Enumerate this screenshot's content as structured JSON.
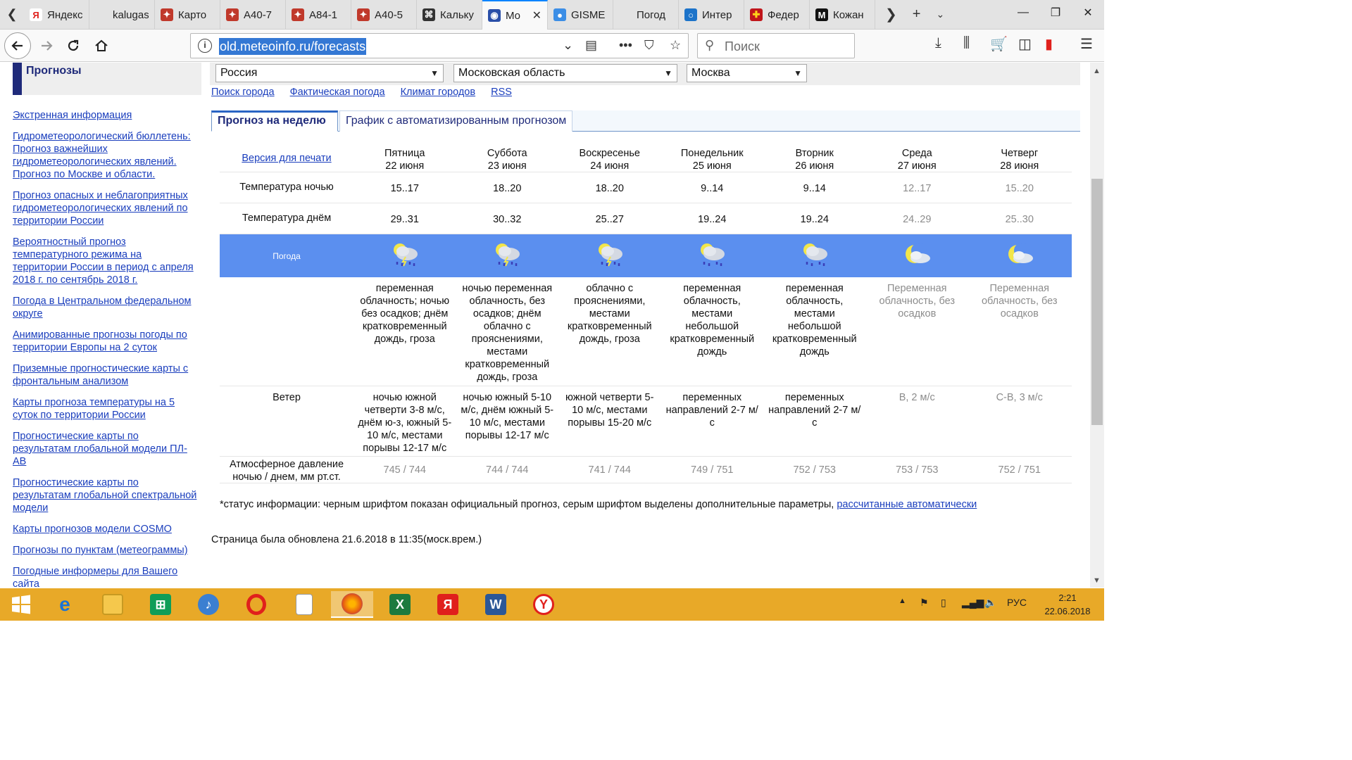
{
  "browser": {
    "tabs": [
      {
        "label": "Яндекс",
        "color": "#ffffff",
        "glyph": "Я",
        "glyph_color": "#e0201c"
      },
      {
        "label": "kalugasad",
        "color": "#e3e3e3",
        "glyph": "",
        "glyph_color": "#333"
      },
      {
        "label": "Карто",
        "color": "#c0392b",
        "glyph": "✦",
        "glyph_color": "#fff"
      },
      {
        "label": "А40-7",
        "color": "#c0392b",
        "glyph": "✦",
        "glyph_color": "#fff"
      },
      {
        "label": "А84-1",
        "color": "#c0392b",
        "glyph": "✦",
        "glyph_color": "#fff"
      },
      {
        "label": "А40-5",
        "color": "#c0392b",
        "glyph": "✦",
        "glyph_color": "#fff"
      },
      {
        "label": "Кальку",
        "color": "#333333",
        "glyph": "⌘",
        "glyph_color": "#fff"
      },
      {
        "label": "Мо",
        "color": "#2a4fa8",
        "glyph": "◉",
        "glyph_color": "#fff",
        "active": true
      },
      {
        "label": "GISME",
        "color": "#3c8ee6",
        "glyph": "●",
        "glyph_color": "#fff"
      },
      {
        "label": "Погод",
        "color": "#e3e3e3",
        "glyph": "",
        "glyph_color": "#333"
      },
      {
        "label": "Интер",
        "color": "#1c73c9",
        "glyph": "○",
        "glyph_color": "#fff"
      },
      {
        "label": "Федер",
        "color": "#c0161b",
        "glyph": "✚",
        "glyph_color": "#ffd21a"
      },
      {
        "label": "Кожан",
        "color": "#111111",
        "glyph": "M",
        "glyph_color": "#fff"
      }
    ],
    "url": "old.meteoinfo.ru/forecasts",
    "search_placeholder": "Поиск"
  },
  "sidebar": {
    "title": "Прогнозы",
    "links": [
      "Экстренная информация",
      "Гидрометеорологический бюллетень: Прогноз важнейших гидрометеорологических явлений. Прогноз по Москве и области.",
      "Прогноз опасных и неблагоприятных гидрометеорологических явлений по территории России",
      "Вероятностный прогноз температурного режима на территории России в период с апреля 2018 г. по сентябрь 2018 г.",
      "Погода в Центральном федеральном округе",
      "Анимированные прогнозы погоды по территории Европы на 2 суток",
      "Приземные прогностические карты с фронтальным анализом",
      "Карты прогноза температуры на 5 суток по территории России",
      "Прогностические карты по результатам глобальной модели ПЛ-АВ",
      "Прогностические карты по результатам глобальной спектральной модели",
      "Карты прогнозов модели COSMO",
      "Прогнозы по пунктам (метеограммы)",
      "Погодные информеры для Вашего сайта"
    ]
  },
  "selectors": {
    "country": "Россия",
    "region": "Московская область",
    "city": "Москва"
  },
  "links": [
    "Поиск города",
    "Фактическая погода",
    "Климат городов",
    "RSS"
  ],
  "tabs": {
    "week": "Прогноз на неделю",
    "chart": "График с автоматизированным прогнозом"
  },
  "forecast": {
    "print_label": "Версия для печати",
    "row_labels": {
      "night_temp": "Температура ночью",
      "day_temp": "Температура днём",
      "weather": "Погода",
      "wind": "Ветер",
      "pressure": "Атмосферное давление ночью / днем, мм рт.ст."
    },
    "days": [
      {
        "day": "Пятница",
        "date": "22 июня",
        "night": "15..17",
        "daytemp": "29..31",
        "icon": "rain-storm",
        "desc": "переменная облачность; ночью без осадков; днём кратковременный дождь, гроза",
        "wind": "ночью южной четверти 3-8 м/с, днём ю-з, южный 5-10 м/с, местами порывы 12-17 м/с",
        "pressure": "745 / 744",
        "auto": false
      },
      {
        "day": "Суббота",
        "date": "23 июня",
        "night": "18..20",
        "daytemp": "30..32",
        "icon": "rain-storm",
        "desc": "ночью переменная облачность, без осадков; днём облачно с прояснениями, местами кратковременный дождь, гроза",
        "wind": "ночью южный 5-10 м/с, днём южный 5-10 м/с, местами порывы 12-17 м/с",
        "pressure": "744 / 744",
        "auto": false
      },
      {
        "day": "Воскресенье",
        "date": "24 июня",
        "night": "18..20",
        "daytemp": "25..27",
        "icon": "rain-storm",
        "desc": "облачно с прояснениями, местами кратковременный дождь, гроза",
        "wind": "южной четверти 5-10 м/с, местами порывы 15-20 м/с",
        "pressure": "741 / 744",
        "auto": false
      },
      {
        "day": "Понедельник",
        "date": "25 июня",
        "night": "9..14",
        "daytemp": "19..24",
        "icon": "rain",
        "desc": "переменная облачность, местами небольшой кратковременный дождь",
        "wind": "переменных направлений 2-7 м/с",
        "pressure": "749 / 751",
        "auto": false
      },
      {
        "day": "Вторник",
        "date": "26 июня",
        "night": "9..14",
        "daytemp": "19..24",
        "icon": "rain",
        "desc": "переменная облачность, местами небольшой кратковременный дождь",
        "wind": "переменных направлений 2-7 м/с",
        "pressure": "752 / 753",
        "auto": false
      },
      {
        "day": "Среда",
        "date": "27 июня",
        "night": "12..17",
        "daytemp": "24..29",
        "icon": "moon-cloud",
        "desc": "Переменная облачность, без осадков",
        "wind": "В, 2 м/с",
        "pressure": "753 / 753",
        "auto": true
      },
      {
        "day": "Четверг",
        "date": "28 июня",
        "night": "15..20",
        "daytemp": "25..30",
        "icon": "moon-cloud",
        "desc": "Переменная облачность, без осадков",
        "wind": "С-В, 3 м/с",
        "pressure": "752 / 751",
        "auto": true
      }
    ]
  },
  "note": {
    "text": "*статус информации: черным шрифтом показан официальный прогноз, серым шрифтом выделены дополнительные параметры, ",
    "link": "рассчитанные автоматически"
  },
  "updated": "Страница была обновлена 21.6.2018 в 11:35(моск.врем.)",
  "taskbar": {
    "lang": "РУС",
    "time": "2:21",
    "date": "22.06.2018"
  }
}
